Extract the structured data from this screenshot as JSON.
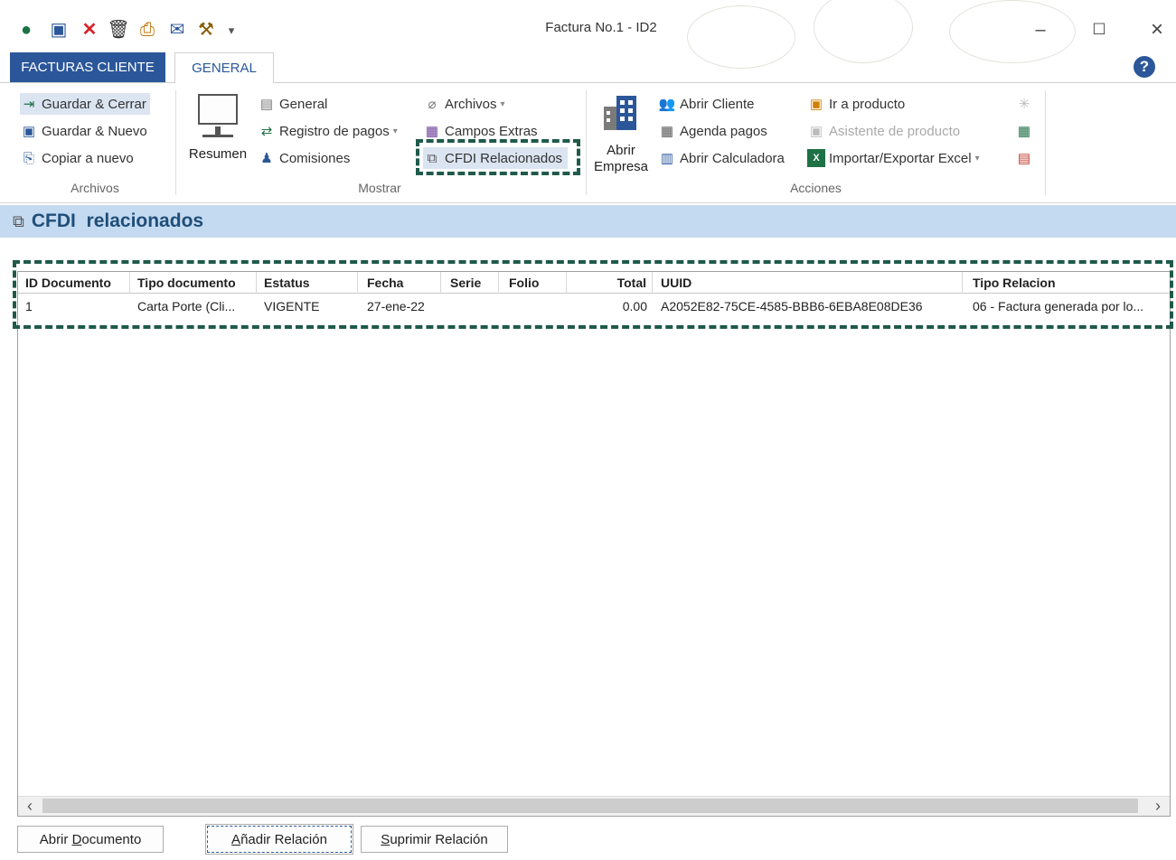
{
  "window": {
    "title": "Factura No.1 - ID2",
    "quick_access_icons": [
      "app-icon",
      "save-icon",
      "delete-icon",
      "trash-icon",
      "print-icon",
      "email-icon",
      "tools-icon",
      "dropdown-icon"
    ],
    "controls": {
      "minimize": "–",
      "maximize": "☐",
      "close": "×"
    }
  },
  "tabs": {
    "facturas": "FACTURAS CLIENTE",
    "general": "GENERAL"
  },
  "ribbon": {
    "archivos": {
      "label": "Archivos",
      "items": [
        "Guardar & Cerrar",
        "Guardar & Nuevo",
        "Copiar a nuevo"
      ]
    },
    "mostrar": {
      "label": "Mostrar",
      "resumen": "Resumen",
      "general": "General",
      "registro_pagos": "Registro de pagos",
      "comisiones": "Comisiones",
      "archivos": "Archivos",
      "campos_extras": "Campos Extras",
      "cfdi_relacionados": "CFDI Relacionados"
    },
    "acciones": {
      "label": "Acciones",
      "abrir_empresa": [
        "Abrir",
        "Empresa"
      ],
      "abrir_cliente": "Abrir Cliente",
      "agenda_pagos": "Agenda pagos",
      "abrir_calculadora": "Abrir Calculadora",
      "ir_producto": "Ir a producto",
      "asistente_producto": "Asistente de producto",
      "importar_exportar": "Importar/Exportar Excel"
    }
  },
  "section": {
    "title": "CFDI  relacionados"
  },
  "grid": {
    "columns": [
      "ID Documento",
      "Tipo documento",
      "Estatus",
      "Fecha",
      "Serie",
      "Folio",
      "Total",
      "UUID",
      "Tipo Relacion"
    ],
    "rows": [
      {
        "id": "1",
        "tipo": "Carta Porte (Cli...",
        "estatus": "VIGENTE",
        "fecha": "27-ene-22",
        "serie": "",
        "folio": "",
        "total": "0.00",
        "uuid": "A2052E82-75CE-4585-BBB6-6EBA8E08DE36",
        "relacion": "06 - Factura generada por lo..."
      }
    ]
  },
  "buttons": {
    "abrir": {
      "before": "Abrir ",
      "key": "D",
      "after": "ocumento"
    },
    "anadir": {
      "key": "A",
      "after": "ñadir Relación"
    },
    "suprimir": {
      "key": "S",
      "after": "uprimir Relación"
    }
  },
  "colors": {
    "accent": "#2b579a",
    "highlight_dash": "#1f5a4a",
    "section_bg": "#c4daf1"
  }
}
